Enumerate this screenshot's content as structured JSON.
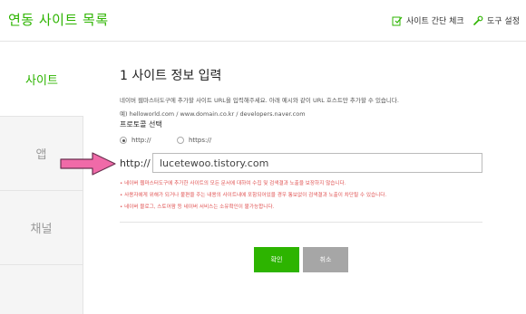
{
  "header": {
    "title": "연동 사이트 목록",
    "site_check_label": "사이트 간단 체크",
    "tool_settings_label": "도구 설정"
  },
  "sidebar": {
    "tabs": [
      {
        "label": "사이트",
        "active": true
      },
      {
        "label": "앱",
        "active": false
      },
      {
        "label": "채널",
        "active": false
      }
    ]
  },
  "form": {
    "section_title": "1 사이트 정보 입력",
    "description": "네이버 웹마스터도구에 추가할 사이트 URL을 입력해주세요. 아래 예시와 같이 URL 호스트만 추가할 수 있습니다.",
    "example": "예) helloworld.com / www.domain.co.kr / developers.naver.com",
    "protocol_label": "프로토콜 선택",
    "protocols": [
      {
        "label": "http://",
        "selected": true
      },
      {
        "label": "https://",
        "selected": false
      }
    ],
    "url_prefix": "http://",
    "url_value": "lucetewoo.tistory.com",
    "notes": [
      "• 네이버 웹마스터도구에 추가한 사이트의 모든 문서에 대하여 수집 및 검색결과 노출을 보장하지 않습니다.",
      "• 사용자에게 위해가 되거나 불편을 주는 내용의 사이트내에 포함되어있을 경우 통보없이 검색결과 노출이 차단될 수 있습니다.",
      "• 네이버 블로그, 스토어팜 등 네이버 서비스는 소유확인이 불가능합니다."
    ]
  },
  "buttons": {
    "confirm_label": "확인",
    "cancel_label": "취소"
  },
  "colors": {
    "accent": "#2db400",
    "note_red": "#e05252",
    "arrow_pink": "#f06aa8"
  }
}
